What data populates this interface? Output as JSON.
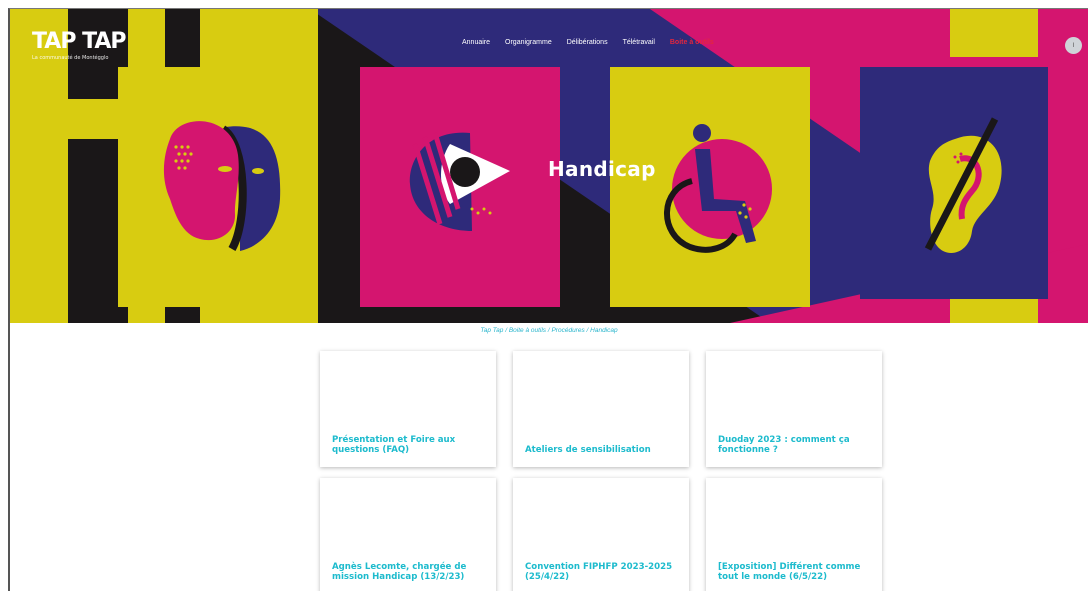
{
  "logo": {
    "name": "TAP TAP",
    "tagline": "La communauté de Montégglo"
  },
  "nav": [
    "Annuaire",
    "Organigramme",
    "Délibérations",
    "Télétravail",
    "Boite à outils"
  ],
  "user": {
    "initial": "I"
  },
  "hero": {
    "title": "Handicap"
  },
  "breadcrumb": [
    "Tap Tap",
    " / ",
    "Boite à outils",
    " / ",
    "Procédures",
    " / ",
    "Handicap"
  ],
  "cards": [
    {
      "title": "Présentation et Foire aux questions (FAQ)"
    },
    {
      "title": "Ateliers de sensibilisation"
    },
    {
      "title": "Duoday 2023 : comment ça fonctionne ?"
    },
    {
      "title": "Agnès Lecomte, chargée de mission Handicap (13/2/23)"
    },
    {
      "title": "Convention FIPHFP 2023-2025 (25/4/22)"
    },
    {
      "title": "[Exposition] Différent comme tout le monde (6/5/22)"
    }
  ],
  "colors": {
    "yellow": "#d8cc11",
    "magenta": "#d4156f",
    "navy": "#2e2a7a",
    "black": "#1a1718",
    "accent": "#1dbbcd",
    "active_nav": "#e3263e"
  }
}
